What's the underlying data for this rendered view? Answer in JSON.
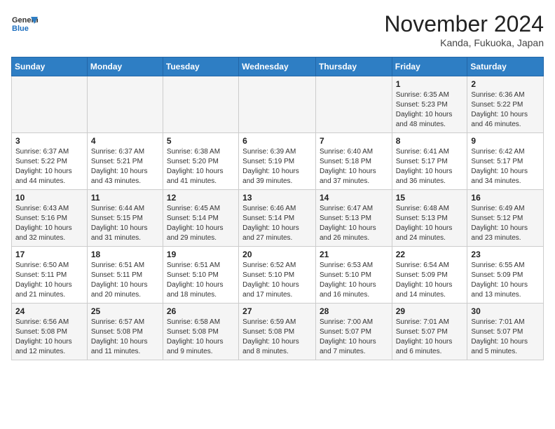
{
  "header": {
    "logo": {
      "line1": "General",
      "line2": "Blue"
    },
    "title": "November 2024",
    "location": "Kanda, Fukuoka, Japan"
  },
  "calendar": {
    "days_of_week": [
      "Sunday",
      "Monday",
      "Tuesday",
      "Wednesday",
      "Thursday",
      "Friday",
      "Saturday"
    ],
    "weeks": [
      [
        {
          "day": "",
          "content": ""
        },
        {
          "day": "",
          "content": ""
        },
        {
          "day": "",
          "content": ""
        },
        {
          "day": "",
          "content": ""
        },
        {
          "day": "",
          "content": ""
        },
        {
          "day": "1",
          "content": "Sunrise: 6:35 AM\nSunset: 5:23 PM\nDaylight: 10 hours\nand 48 minutes."
        },
        {
          "day": "2",
          "content": "Sunrise: 6:36 AM\nSunset: 5:22 PM\nDaylight: 10 hours\nand 46 minutes."
        }
      ],
      [
        {
          "day": "3",
          "content": "Sunrise: 6:37 AM\nSunset: 5:22 PM\nDaylight: 10 hours\nand 44 minutes."
        },
        {
          "day": "4",
          "content": "Sunrise: 6:37 AM\nSunset: 5:21 PM\nDaylight: 10 hours\nand 43 minutes."
        },
        {
          "day": "5",
          "content": "Sunrise: 6:38 AM\nSunset: 5:20 PM\nDaylight: 10 hours\nand 41 minutes."
        },
        {
          "day": "6",
          "content": "Sunrise: 6:39 AM\nSunset: 5:19 PM\nDaylight: 10 hours\nand 39 minutes."
        },
        {
          "day": "7",
          "content": "Sunrise: 6:40 AM\nSunset: 5:18 PM\nDaylight: 10 hours\nand 37 minutes."
        },
        {
          "day": "8",
          "content": "Sunrise: 6:41 AM\nSunset: 5:17 PM\nDaylight: 10 hours\nand 36 minutes."
        },
        {
          "day": "9",
          "content": "Sunrise: 6:42 AM\nSunset: 5:17 PM\nDaylight: 10 hours\nand 34 minutes."
        }
      ],
      [
        {
          "day": "10",
          "content": "Sunrise: 6:43 AM\nSunset: 5:16 PM\nDaylight: 10 hours\nand 32 minutes."
        },
        {
          "day": "11",
          "content": "Sunrise: 6:44 AM\nSunset: 5:15 PM\nDaylight: 10 hours\nand 31 minutes."
        },
        {
          "day": "12",
          "content": "Sunrise: 6:45 AM\nSunset: 5:14 PM\nDaylight: 10 hours\nand 29 minutes."
        },
        {
          "day": "13",
          "content": "Sunrise: 6:46 AM\nSunset: 5:14 PM\nDaylight: 10 hours\nand 27 minutes."
        },
        {
          "day": "14",
          "content": "Sunrise: 6:47 AM\nSunset: 5:13 PM\nDaylight: 10 hours\nand 26 minutes."
        },
        {
          "day": "15",
          "content": "Sunrise: 6:48 AM\nSunset: 5:13 PM\nDaylight: 10 hours\nand 24 minutes."
        },
        {
          "day": "16",
          "content": "Sunrise: 6:49 AM\nSunset: 5:12 PM\nDaylight: 10 hours\nand 23 minutes."
        }
      ],
      [
        {
          "day": "17",
          "content": "Sunrise: 6:50 AM\nSunset: 5:11 PM\nDaylight: 10 hours\nand 21 minutes."
        },
        {
          "day": "18",
          "content": "Sunrise: 6:51 AM\nSunset: 5:11 PM\nDaylight: 10 hours\nand 20 minutes."
        },
        {
          "day": "19",
          "content": "Sunrise: 6:51 AM\nSunset: 5:10 PM\nDaylight: 10 hours\nand 18 minutes."
        },
        {
          "day": "20",
          "content": "Sunrise: 6:52 AM\nSunset: 5:10 PM\nDaylight: 10 hours\nand 17 minutes."
        },
        {
          "day": "21",
          "content": "Sunrise: 6:53 AM\nSunset: 5:10 PM\nDaylight: 10 hours\nand 16 minutes."
        },
        {
          "day": "22",
          "content": "Sunrise: 6:54 AM\nSunset: 5:09 PM\nDaylight: 10 hours\nand 14 minutes."
        },
        {
          "day": "23",
          "content": "Sunrise: 6:55 AM\nSunset: 5:09 PM\nDaylight: 10 hours\nand 13 minutes."
        }
      ],
      [
        {
          "day": "24",
          "content": "Sunrise: 6:56 AM\nSunset: 5:08 PM\nDaylight: 10 hours\nand 12 minutes."
        },
        {
          "day": "25",
          "content": "Sunrise: 6:57 AM\nSunset: 5:08 PM\nDaylight: 10 hours\nand 11 minutes."
        },
        {
          "day": "26",
          "content": "Sunrise: 6:58 AM\nSunset: 5:08 PM\nDaylight: 10 hours\nand 9 minutes."
        },
        {
          "day": "27",
          "content": "Sunrise: 6:59 AM\nSunset: 5:08 PM\nDaylight: 10 hours\nand 8 minutes."
        },
        {
          "day": "28",
          "content": "Sunrise: 7:00 AM\nSunset: 5:07 PM\nDaylight: 10 hours\nand 7 minutes."
        },
        {
          "day": "29",
          "content": "Sunrise: 7:01 AM\nSunset: 5:07 PM\nDaylight: 10 hours\nand 6 minutes."
        },
        {
          "day": "30",
          "content": "Sunrise: 7:01 AM\nSunset: 5:07 PM\nDaylight: 10 hours\nand 5 minutes."
        }
      ]
    ]
  }
}
